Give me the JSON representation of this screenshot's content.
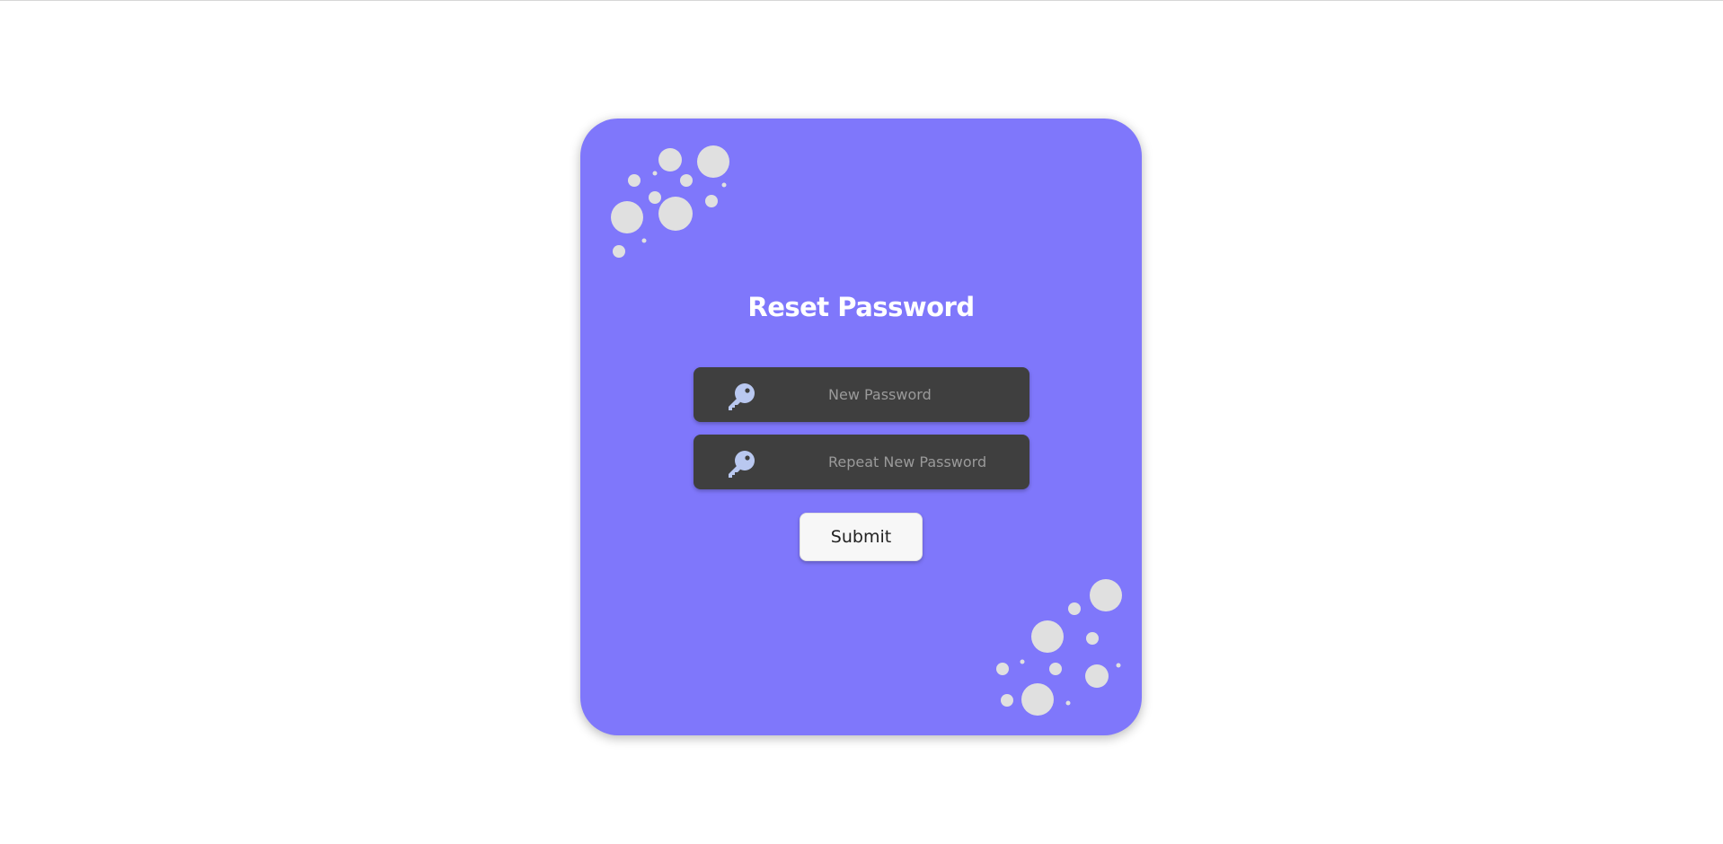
{
  "form": {
    "title": "Reset Password",
    "new_password_placeholder": "New Password",
    "repeat_password_placeholder": "Repeat New Password",
    "submit_label": "Submit"
  },
  "icons": {
    "field_icon": "key-icon"
  },
  "colors": {
    "card_background": "#7f77fb",
    "field_background": "#3f3f3f",
    "bubble": "#e0e0e0",
    "key_icon": "#b9c8f0"
  }
}
